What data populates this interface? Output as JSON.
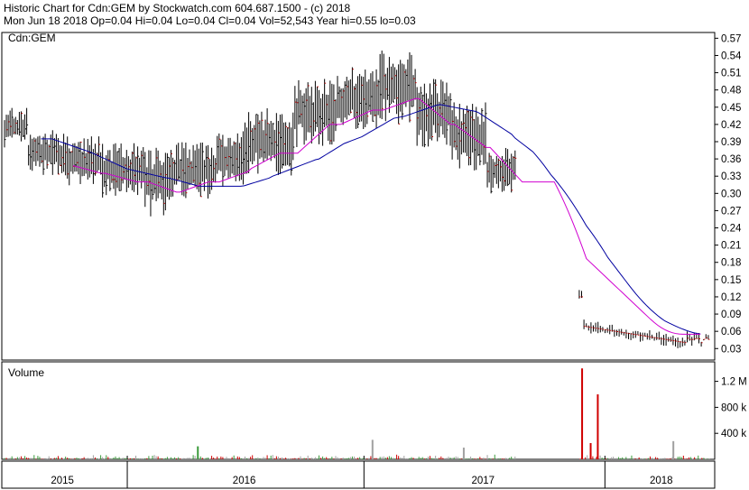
{
  "header": {
    "line1": "Historic Chart for Cdn:GEM by Stockwatch.com 604.687.1500 - (c) 2018",
    "line2": "Mon Jun 18 2018  Op=0.04  Hi=0.04  Lo=0.04  Cl=0.04  Vol=52,543  Year hi=0.55  lo=0.03"
  },
  "chart_data": [
    {
      "type": "bar",
      "subtype": "hlc-price",
      "title": "Cdn:GEM",
      "ylim": [
        0.01,
        0.58
      ],
      "y_ticks": [
        "0.57",
        "0.54",
        "0.51",
        "0.48",
        "0.45",
        "0.42",
        "0.39",
        "0.36",
        "0.33",
        "0.30",
        "0.27",
        "0.24",
        "0.21",
        "0.18",
        "0.15",
        "0.12",
        "0.09",
        "0.06",
        "0.03"
      ],
      "price_segments": [
        {
          "start": 0.0,
          "end": 0.035,
          "hi": 0.45,
          "lo": 0.38,
          "close": 0.4
        },
        {
          "start": 0.035,
          "end": 0.09,
          "hi": 0.41,
          "lo": 0.33,
          "close": 0.35
        },
        {
          "start": 0.09,
          "end": 0.14,
          "hi": 0.4,
          "lo": 0.31,
          "close": 0.35
        },
        {
          "start": 0.14,
          "end": 0.2,
          "hi": 0.39,
          "lo": 0.29,
          "close": 0.3
        },
        {
          "start": 0.2,
          "end": 0.24,
          "hi": 0.38,
          "lo": 0.26,
          "close": 0.3
        },
        {
          "start": 0.24,
          "end": 0.3,
          "hi": 0.39,
          "lo": 0.29,
          "close": 0.33
        },
        {
          "start": 0.3,
          "end": 0.34,
          "hi": 0.41,
          "lo": 0.31,
          "close": 0.34
        },
        {
          "start": 0.34,
          "end": 0.41,
          "hi": 0.45,
          "lo": 0.33,
          "close": 0.36
        },
        {
          "start": 0.41,
          "end": 0.47,
          "hi": 0.5,
          "lo": 0.38,
          "close": 0.4
        },
        {
          "start": 0.47,
          "end": 0.53,
          "hi": 0.52,
          "lo": 0.41,
          "close": 0.44
        },
        {
          "start": 0.53,
          "end": 0.58,
          "hi": 0.55,
          "lo": 0.42,
          "close": 0.46
        },
        {
          "start": 0.58,
          "end": 0.63,
          "hi": 0.5,
          "lo": 0.38,
          "close": 0.42
        },
        {
          "start": 0.63,
          "end": 0.68,
          "hi": 0.46,
          "lo": 0.34,
          "close": 0.4
        },
        {
          "start": 0.68,
          "end": 0.72,
          "hi": 0.38,
          "lo": 0.3,
          "close": 0.33
        }
      ],
      "ma_series": [
        {
          "color": "#0000a0",
          "role": "long-ma"
        },
        {
          "color": "#d000d0",
          "role": "short-ma"
        }
      ]
    },
    {
      "type": "bar",
      "title": "Volume",
      "ylim": [
        0,
        1500000
      ],
      "y_ticks": [
        "1.2 M",
        "800 k",
        "400 k"
      ],
      "up_color": "#3a9a3a",
      "down_color": "#d00000",
      "neutral_color": "#a0a0a0",
      "spikes": [
        {
          "pos": 0.814,
          "value": 1400000,
          "color": "#d00000"
        },
        {
          "pos": 0.836,
          "value": 1000000,
          "color": "#d00000"
        },
        {
          "pos": 0.826,
          "value": 250000,
          "color": "#d00000"
        },
        {
          "pos": 0.52,
          "value": 300000,
          "color": "#a0a0a0"
        },
        {
          "pos": 0.942,
          "value": 280000,
          "color": "#a0a0a0"
        },
        {
          "pos": 0.648,
          "value": 180000,
          "color": "#a0a0a0"
        },
        {
          "pos": 0.275,
          "value": 200000,
          "color": "#3a9a3a"
        }
      ]
    }
  ],
  "x_axis": {
    "year_labels": [
      {
        "text": "2015",
        "pos": 0.085
      },
      {
        "text": "2016",
        "pos": 0.34
      },
      {
        "text": "2017",
        "pos": 0.675
      },
      {
        "text": "2018",
        "pos": 0.925
      }
    ],
    "year_dividers": [
      0.176,
      0.508,
      0.846
    ]
  }
}
